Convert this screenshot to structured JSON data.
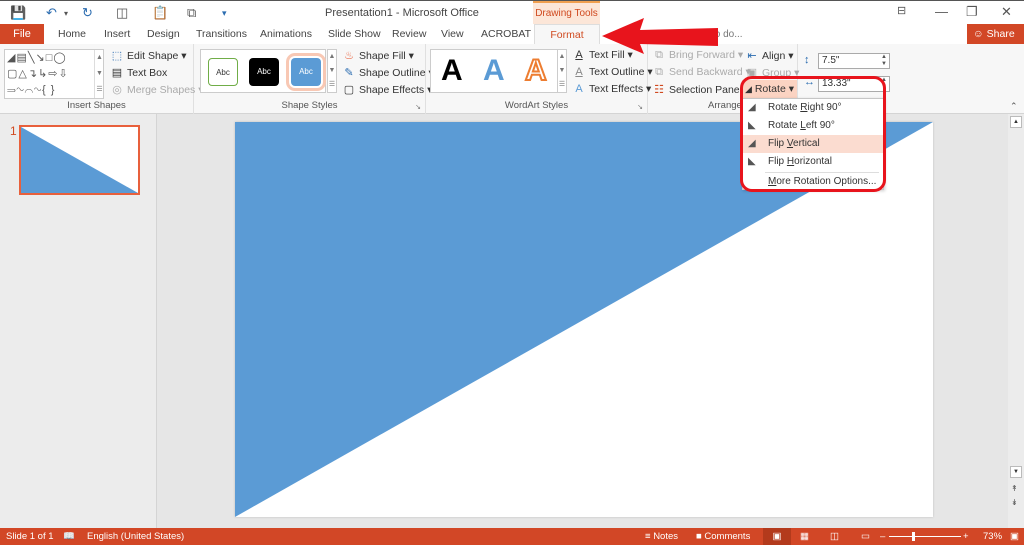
{
  "window": {
    "title": "Presentation1 - Microsoft Office",
    "contextual_tab_group": "Drawing Tools",
    "buttons": [
      "ribbon-display-options",
      "minimize",
      "restore",
      "close"
    ]
  },
  "quick_access": [
    "save",
    "undo",
    "redo",
    "present",
    "paste",
    "copy",
    "customize"
  ],
  "tabs": {
    "file": "File",
    "items": [
      "Home",
      "Insert",
      "Design",
      "Transitions",
      "Animations",
      "Slide Show",
      "Review",
      "View",
      "ACROBAT"
    ],
    "active": "Format",
    "tell_me": "to do...",
    "share": "Share"
  },
  "ribbon": {
    "insert_shapes": {
      "label": "Insert Shapes",
      "edit_shape": "Edit Shape",
      "text_box": "Text Box",
      "merge_shapes": "Merge Shapes"
    },
    "shape_styles": {
      "label": "Shape Styles",
      "swatch_text": "Abc",
      "shape_fill": "Shape Fill",
      "shape_outline": "Shape Outline",
      "shape_effects": "Shape Effects"
    },
    "wordart_styles": {
      "label": "WordArt Styles",
      "sample": "A",
      "text_fill": "Text Fill",
      "text_outline": "Text Outline",
      "text_effects": "Text Effects"
    },
    "arrange": {
      "label": "Arrange",
      "bring_forward": "Bring Forward",
      "send_backward": "Send Backward",
      "selection_pane": "Selection Pane",
      "align": "Align",
      "group": "Group",
      "rotate": "Rotate"
    },
    "size": {
      "height": "7.5\"",
      "width": "13.33\""
    }
  },
  "rotate_menu": {
    "items": [
      {
        "pre": "Rotate ",
        "key": "R",
        "post": "ight 90°"
      },
      {
        "pre": "Rotate ",
        "key": "L",
        "post": "eft 90°"
      },
      {
        "pre": "Flip ",
        "key": "V",
        "post": "ertical"
      },
      {
        "pre": "Flip ",
        "key": "H",
        "post": "orizontal"
      },
      {
        "pre": "",
        "key": "M",
        "post": "ore Rotation Options..."
      }
    ],
    "highlighted": "Flip Vertical"
  },
  "slides": {
    "thumbnail_number": "1"
  },
  "colors": {
    "accent": "#d24726",
    "shape_fill": "#5b9bd5",
    "annotation_red": "#e8141c"
  },
  "status": {
    "slide": "Slide 1 of 1",
    "language": "English (United States)",
    "notes": "Notes",
    "comments": "Comments",
    "zoom": "73%"
  }
}
